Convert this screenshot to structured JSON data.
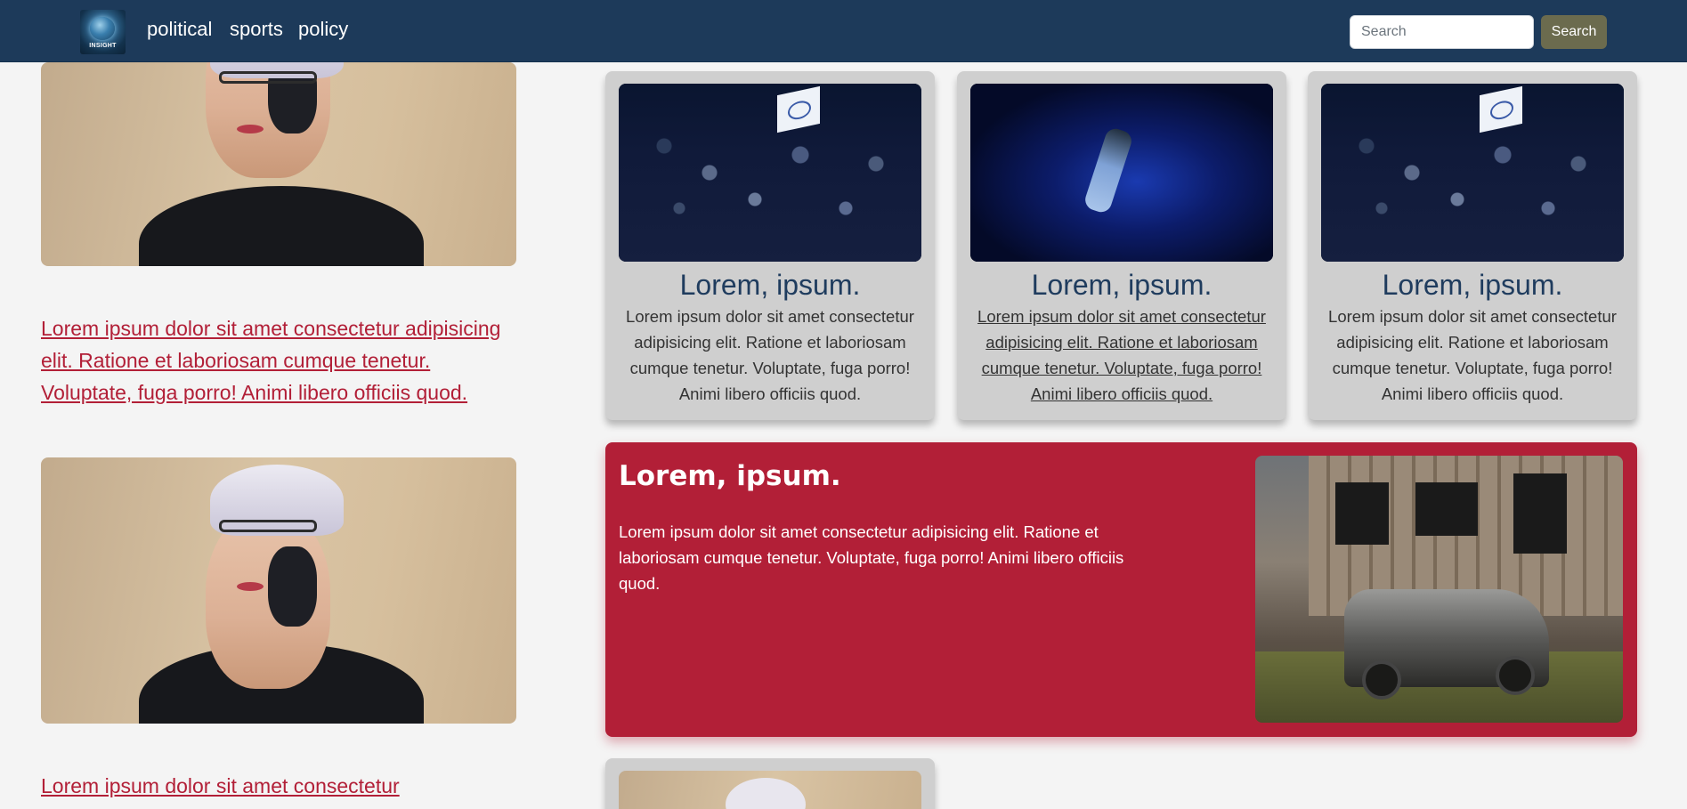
{
  "navbar": {
    "logo_text": "INSIGHT",
    "links": [
      "political",
      "sports",
      "policy"
    ],
    "search": {
      "placeholder": "Search",
      "button_label": "Search"
    }
  },
  "left_column": {
    "links": [
      "Lorem ipsum dolor sit amet consectetur adipisicing elit. Ratione et laboriosam cumque tenetur. Voluptate, fuga porro! Animi libero officiis quod.",
      "Lorem ipsum dolor sit amet consectetur"
    ]
  },
  "cards": [
    {
      "title": "Lorem, ipsum.",
      "text": "Lorem ipsum dolor sit amet consectetur adipisicing elit. Ratione et laboriosam cumque tenetur. Voluptate, fuga porro! Animi libero officiis quod."
    },
    {
      "title": "Lorem, ipsum.",
      "text": "Lorem ipsum dolor sit amet consectetur adipisicing elit. Ratione et laboriosam cumque tenetur. Voluptate, fuga porro! Animi libero officiis quod."
    },
    {
      "title": "Lorem, ipsum.",
      "text": "Lorem ipsum dolor sit amet consectetur adipisicing elit. Ratione et laboriosam cumque tenetur. Voluptate, fuga porro! Animi libero officiis quod."
    }
  ],
  "feature": {
    "title": "Lorem, ipsum.",
    "text": "Lorem ipsum dolor sit amet consectetur adipisicing elit. Ratione et laboriosam cumque tenetur. Voluptate, fuga porro! Animi libero officiis quod."
  },
  "colors": {
    "navbar": "#1d3a5a",
    "accent_red": "#b21f37",
    "card_bg": "#cfcfcf",
    "search_button": "#6b6b4e",
    "card_title": "#1f3c5e"
  }
}
